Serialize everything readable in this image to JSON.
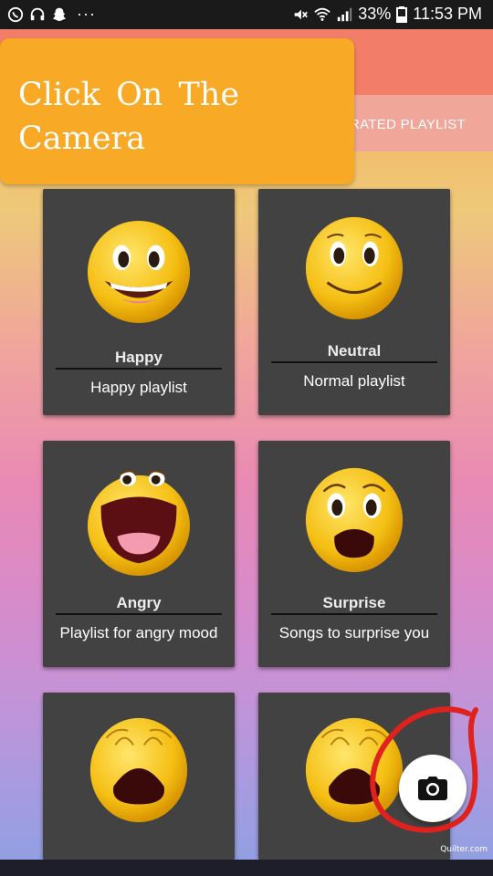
{
  "status_bar": {
    "battery": "33%",
    "time": "11:53 PM",
    "left_icons": [
      "whatsapp-icon",
      "headset-icon",
      "snapchat-icon",
      "more-icon"
    ],
    "right_icons": [
      "mute-icon",
      "wifi-icon",
      "signal-icon",
      "battery-icon"
    ]
  },
  "tabs": {
    "visible_label": "RATED PLAYLIST"
  },
  "tooltip": {
    "text": "Click On The Camera"
  },
  "cards": [
    {
      "mood": "Happy",
      "description": "Happy playlist",
      "face": "happy-face-icon"
    },
    {
      "mood": "Neutral",
      "description": "Normal playlist",
      "face": "neutral-face-icon"
    },
    {
      "mood": "Angry",
      "description": "Playlist for angry mood",
      "face": "angry-face-icon"
    },
    {
      "mood": "Surprise",
      "description": "Songs to surprise you",
      "face": "surprise-face-icon"
    },
    {
      "mood": "",
      "description": "",
      "face": "sad-face-icon"
    },
    {
      "mood": "",
      "description": "",
      "face": "sad-face-icon"
    }
  ],
  "fab": {
    "icon": "camera-icon"
  },
  "watermark": "Quilter.com",
  "colors": {
    "appbar": "#f27e6a",
    "tooltip": "#f8a925",
    "card": "#424242",
    "annotation": "#e0221e"
  }
}
